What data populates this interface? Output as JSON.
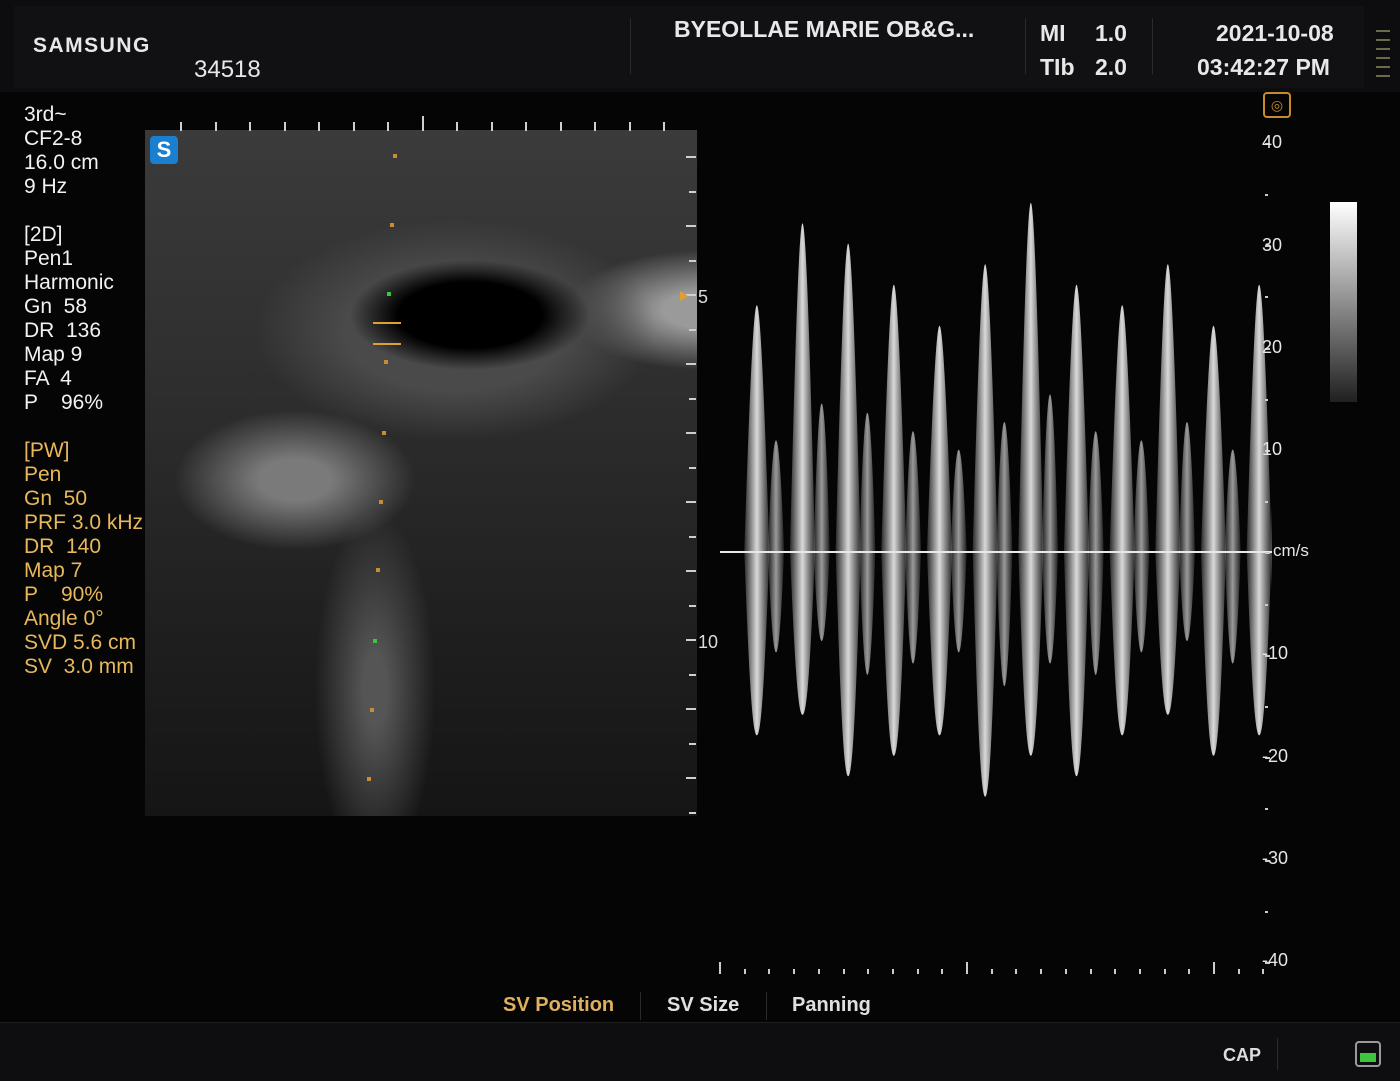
{
  "header": {
    "brand": "SAMSUNG",
    "patient_id": "34518",
    "hospital": "BYEOLLAE MARIE OB&G...",
    "mi_label": "MI",
    "mi_value": "1.0",
    "tib_label": "TIb",
    "tib_value": "2.0",
    "date": "2021-10-08",
    "time": "03:42:27 PM"
  },
  "params_2d": {
    "preset": "3rd~",
    "probe": "CF2-8",
    "depth": "16.0 cm",
    "frame_rate": "9 Hz",
    "mode": "[2D]",
    "pen": "Pen1",
    "harmonic": "Harmonic",
    "gain": "Gn  58",
    "dr": "DR  136",
    "map": "Map 9",
    "fa": "FA  4",
    "power": "P    96%"
  },
  "params_pw": {
    "mode": "[PW]",
    "pen": "Pen",
    "gain": "Gn  50",
    "prf": "PRF 3.0 kHz",
    "dr": "DR  140",
    "map": "Map 7",
    "power": "P    90%",
    "angle": "Angle 0°",
    "svd": "SVD 5.6 cm",
    "sv": "SV  3.0 mm"
  },
  "image": {
    "badge": "S",
    "depth_marks": [
      "5",
      "10"
    ]
  },
  "doppler": {
    "unit": "cm/s",
    "scale": [
      "40",
      "30",
      "20",
      "10",
      "-10",
      "-20",
      "-30",
      "-40"
    ],
    "peak_envelope_cm_s": [
      24,
      32,
      30,
      26,
      22,
      28,
      34,
      26,
      24,
      28,
      22,
      26
    ],
    "trough_envelope_cm_s": [
      -18,
      -16,
      -22,
      -20,
      -18,
      -24,
      -20,
      -22,
      -18,
      -16,
      -20,
      -18
    ]
  },
  "softkeys": {
    "sv_position": "SV Position",
    "sv_size": "SV Size",
    "panning": "Panning"
  },
  "status": {
    "cap": "CAP"
  },
  "colors": {
    "pw_text": "#e8b85a",
    "active_softkey": "#e0b060",
    "badge": "#1b7fd0",
    "storage": "#3ec43e"
  }
}
